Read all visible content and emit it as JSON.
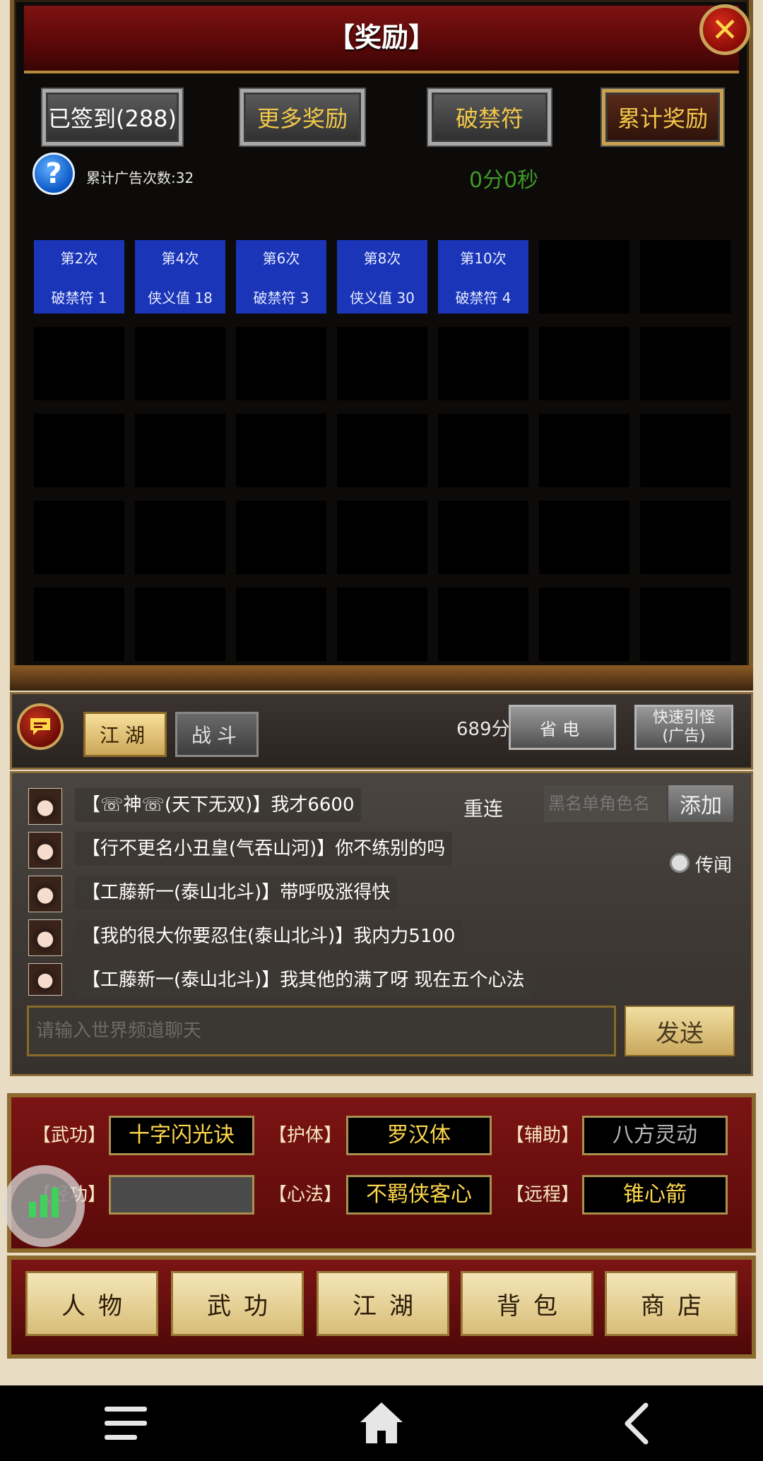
{
  "reward": {
    "title": "【奖励】",
    "close": "✕",
    "buttons": {
      "signed": "已签到(288)",
      "more": "更多奖励",
      "break": "破禁符",
      "total": "累计奖励"
    },
    "help": "?",
    "ad_count": "累计广告次数:32",
    "timer": "0分0秒",
    "cells": [
      {
        "times": "第2次",
        "reward": "破禁符 1"
      },
      {
        "times": "第4次",
        "reward": "侠义值 18"
      },
      {
        "times": "第6次",
        "reward": "破禁符 3"
      },
      {
        "times": "第8次",
        "reward": "侠义值 30"
      },
      {
        "times": "第10次",
        "reward": "破禁符 4"
      }
    ]
  },
  "chat": {
    "tabs": {
      "jianghu": "江湖",
      "battle": "战斗"
    },
    "score": "689分",
    "power_save": "省电",
    "quick_monster": "快速引怪\n(广告)",
    "reconnect": "重连",
    "blacklist_placeholder": "黑名单角色名",
    "add": "添加",
    "rumor": "传闻",
    "input_placeholder": "请输入世界频道聊天",
    "send": "发送",
    "messages": [
      "【☏神☏(天下无双)】我才6600",
      "【行不更名小丑皇(气吞山河)】你不练别的吗",
      "【工藤新一(泰山北斗)】带呼吸涨得快",
      "【我的很大你要忍住(泰山北斗)】我内力5100",
      "【工藤新一(泰山北斗)】我其他的满了呀  现在五个心法"
    ]
  },
  "skills": {
    "martial_label": "【武功】",
    "martial": "十字闪光诀",
    "body_label": "【护体】",
    "body": "罗汉体",
    "assist_label": "【辅助】",
    "assist": "八方灵动",
    "light_label": "【轻功】",
    "light": "",
    "heart_label": "【心法】",
    "heart": "不羁侠客心",
    "ranged_label": "【远程】",
    "ranged": "锥心箭"
  },
  "nav": {
    "character": "人物",
    "martial": "武功",
    "jianghu": "江湖",
    "bag": "背包",
    "shop": "商店"
  },
  "icons": {
    "close": "close-icon",
    "help": "question-icon",
    "chat": "chat-bubble-icon",
    "voice": "signal-bars-icon",
    "menu": "menu-icon",
    "home": "home-icon",
    "back": "back-icon"
  },
  "colors": {
    "cell_filled": "#1a35b8",
    "title_bar": "#7e1212",
    "gold_text": "#f3c84a",
    "timer": "#3f9a26"
  }
}
